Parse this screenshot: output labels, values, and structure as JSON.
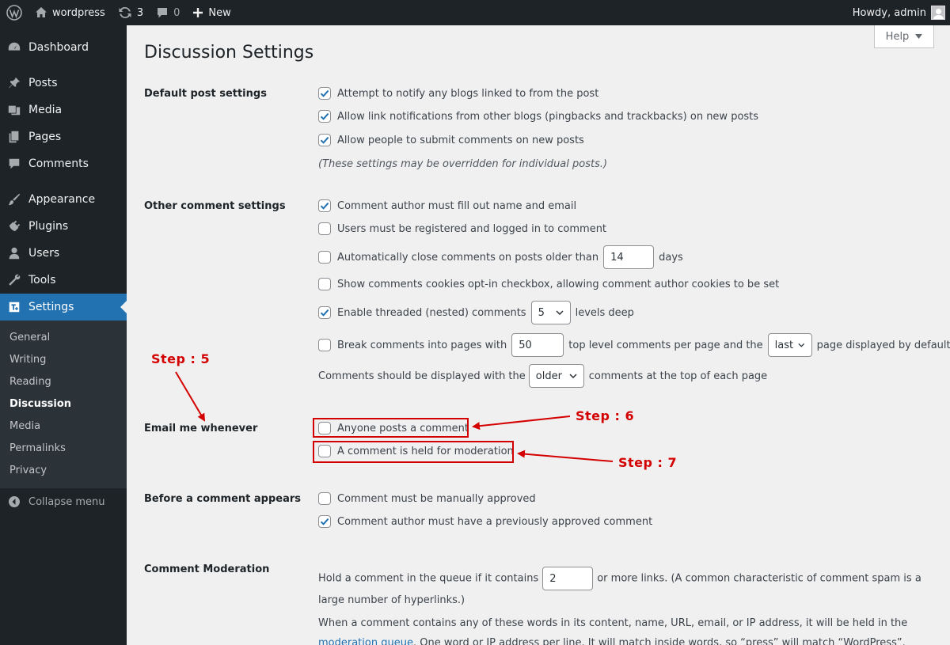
{
  "adminbar": {
    "site_name": "wordpress",
    "updates_count": "3",
    "comments_count": "0",
    "new_label": "New",
    "howdy": "Howdy, admin"
  },
  "sidebar": {
    "items": [
      {
        "label": "Dashboard",
        "icon": "dashboard-icon"
      },
      {
        "label": "Posts",
        "icon": "pin-icon"
      },
      {
        "label": "Media",
        "icon": "media-icon"
      },
      {
        "label": "Pages",
        "icon": "pages-icon"
      },
      {
        "label": "Comments",
        "icon": "comment-icon"
      },
      {
        "label": "Appearance",
        "icon": "brush-icon"
      },
      {
        "label": "Plugins",
        "icon": "plugin-icon"
      },
      {
        "label": "Users",
        "icon": "user-icon"
      },
      {
        "label": "Tools",
        "icon": "wrench-icon"
      },
      {
        "label": "Settings",
        "icon": "settings-icon"
      }
    ],
    "submenu": [
      "General",
      "Writing",
      "Reading",
      "Discussion",
      "Media",
      "Permalinks",
      "Privacy"
    ],
    "collapse_label": "Collapse menu"
  },
  "help_label": "Help",
  "page_title": "Discussion Settings",
  "sections": {
    "default_post": {
      "label": "Default post settings",
      "options": [
        {
          "label": "Attempt to notify any blogs linked to from the post",
          "checked": true
        },
        {
          "label": "Allow link notifications from other blogs (pingbacks and trackbacks) on new posts",
          "checked": true
        },
        {
          "label": "Allow people to submit comments on new posts",
          "checked": true
        }
      ],
      "note": "(These settings may be overridden for individual posts.)"
    },
    "other_comment": {
      "label": "Other comment settings",
      "name_email": "Comment author must fill out name and email",
      "registered": "Users must be registered and logged in to comment",
      "auto_close_before": "Automatically close comments on posts older than",
      "auto_close_days": "14",
      "auto_close_after": "days",
      "cookies": "Show comments cookies opt-in checkbox, allowing comment author cookies to be set",
      "threaded_before": "Enable threaded (nested) comments",
      "threaded_levels": "5",
      "threaded_after": "levels deep",
      "paged_before": "Break comments into pages with",
      "paged_count": "50",
      "paged_middle": "top level comments per page and the",
      "paged_which": "last",
      "paged_after": "page displayed by default",
      "order_before": "Comments should be displayed with the",
      "order_value": "older",
      "order_after": "comments at the top of each page"
    },
    "email_me": {
      "label": "Email me whenever",
      "anyone_posts": "Anyone posts a comment",
      "held_moderation": "A comment is held for moderation"
    },
    "before_appears": {
      "label": "Before a comment appears",
      "manual": "Comment must be manually approved",
      "previously_approved": "Comment author must have a previously approved comment"
    },
    "moderation": {
      "label": "Comment Moderation",
      "hold_before": "Hold a comment in the queue if it contains",
      "hold_links": "2",
      "hold_after": "or more links. (A common characteristic of comment spam is a large number of hyperlinks.)",
      "words_before": "When a comment contains any of these words in its content, name, URL, email, or IP address, it will be held in the",
      "queue_link": "moderation queue",
      "words_after": ". One word or IP address per line. It will match inside words, so “press” will match “WordPress”."
    }
  },
  "annotations": {
    "step5": "Step : 5",
    "step6": "Step : 6",
    "step7": "Step : 7",
    "color": "#d40000"
  },
  "colors": {
    "adminbar": "#1d2327",
    "accent": "#2271b1",
    "submenu_bg": "#2c3338",
    "content_bg": "#f0f0f1"
  }
}
